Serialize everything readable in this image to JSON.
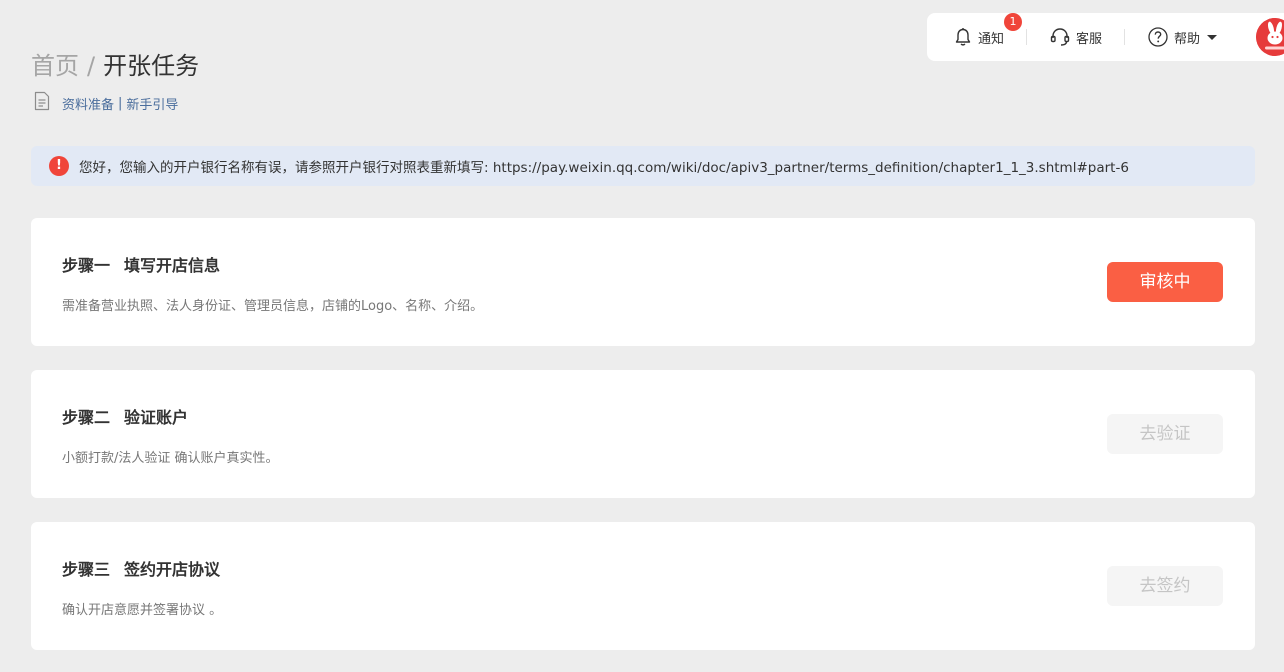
{
  "toolbar": {
    "notify_label": "通知",
    "notify_badge": "1",
    "service_label": "客服",
    "help_label": "帮助"
  },
  "breadcrumb": {
    "home": "首页",
    "separator": "/",
    "current": "开张任务"
  },
  "sublinks": {
    "prep": "资料准备",
    "separator": "|",
    "guide": "新手引导"
  },
  "alert": {
    "message": "您好，您输入的开户银行名称有误，请参照开户银行对照表重新填写: https://pay.weixin.qq.com/wiki/doc/apiv3_partner/terms_definition/chapter1_1_3.shtml#part-6",
    "icon": "!"
  },
  "steps": [
    {
      "step_no": "步骤一",
      "title": "填写开店信息",
      "desc": "需准备营业执照、法人身份证、管理员信息，店铺的Logo、名称、介绍。",
      "button": "审核中"
    },
    {
      "step_no": "步骤二",
      "title": "验证账户",
      "desc": "小额打款/法人验证 确认账户真实性。",
      "button": "去验证"
    },
    {
      "step_no": "步骤三",
      "title": "签约开店协议",
      "desc": "确认开店意愿并签署协议 。",
      "button": "去签约"
    }
  ],
  "colors": {
    "accent": "#fa5f44",
    "alert_bg": "#e2e9f5",
    "badge": "#f0453a",
    "link": "#4a6d9c"
  },
  "icons": [
    "bell-icon",
    "headset-icon",
    "help-circle-icon",
    "caret-down-icon",
    "avatar",
    "document-icon",
    "error-icon"
  ]
}
